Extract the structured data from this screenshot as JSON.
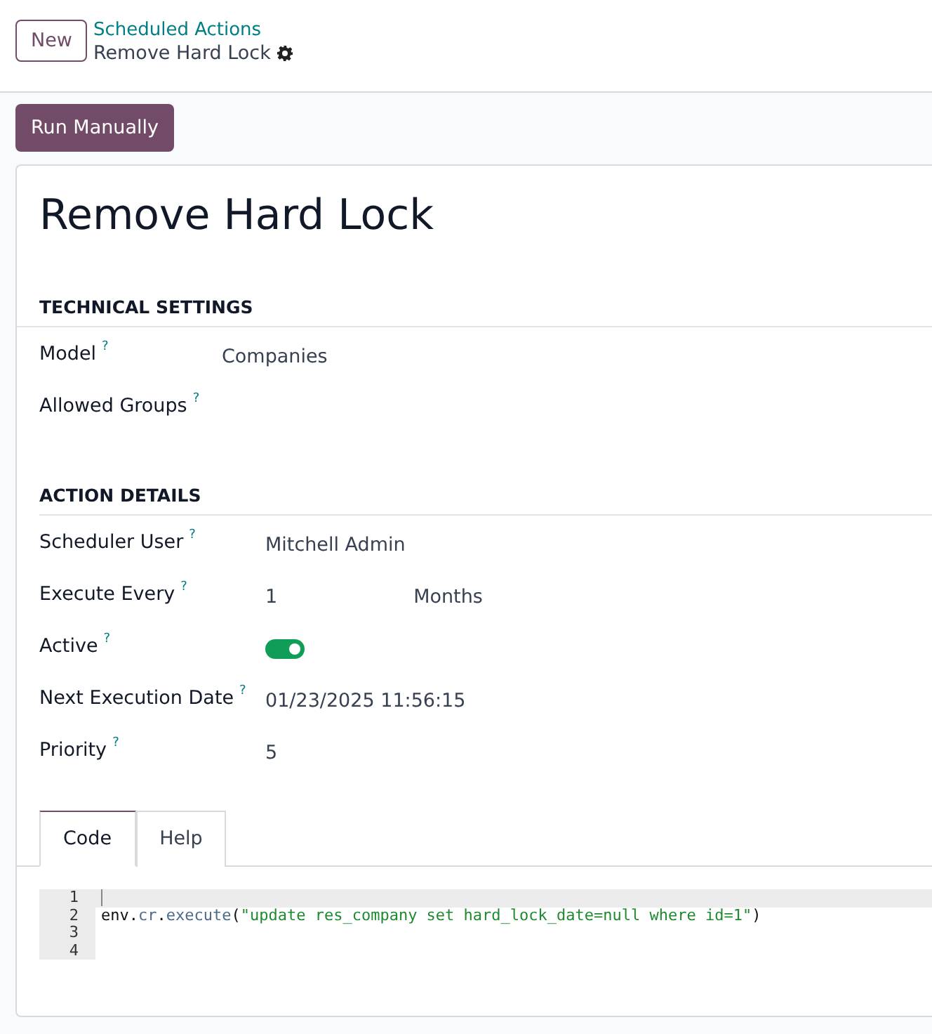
{
  "control_panel": {
    "new_button": "New",
    "breadcrumb": "Scheduled Actions",
    "record_title": "Remove Hard Lock"
  },
  "action_button": "Run Manually",
  "form": {
    "title": "Remove Hard Lock",
    "sections": [
      {
        "heading": "TECHNICAL SETTINGS",
        "fields": [
          {
            "kind": "text",
            "label": "Model",
            "help": "?",
            "value": "Companies"
          },
          {
            "kind": "text",
            "label": "Allowed Groups",
            "help": "?"
          }
        ]
      },
      {
        "heading": "ACTION DETAILS",
        "fields": [
          {
            "kind": "text",
            "label": "Scheduler User",
            "help": "?",
            "value": "Mitchell Admin"
          },
          {
            "kind": "interval",
            "label": "Execute Every",
            "help": "?",
            "value": "1",
            "unit": "Months"
          },
          {
            "kind": "toggle",
            "label": "Active",
            "help": "?",
            "on": true
          },
          {
            "kind": "text",
            "label": "Next Execution Date",
            "help": "?",
            "value": "01/23/2025 11:56:15"
          },
          {
            "kind": "text",
            "label": "Priority",
            "help": "?",
            "value": "5"
          }
        ]
      }
    ]
  },
  "tabs": [
    {
      "label": "Code",
      "selected": true
    },
    {
      "label": "Help",
      "selected": false
    }
  ],
  "code_editor": {
    "lines": [
      {
        "number": "1",
        "active": true
      },
      {
        "number": "2",
        "active": false,
        "tokens": [
          {
            "kind": "plain",
            "text": "env."
          },
          {
            "kind": "attr",
            "text": "cr"
          },
          {
            "kind": "plain",
            "text": "."
          },
          {
            "kind": "attr",
            "text": "execute"
          },
          {
            "kind": "plain",
            "text": "("
          },
          {
            "kind": "string",
            "text": "\"update res_company set hard_lock_date=null where id=1\""
          },
          {
            "kind": "plain",
            "text": ")"
          }
        ]
      },
      {
        "number": "3",
        "active": false
      },
      {
        "number": "4",
        "active": false
      }
    ]
  }
}
